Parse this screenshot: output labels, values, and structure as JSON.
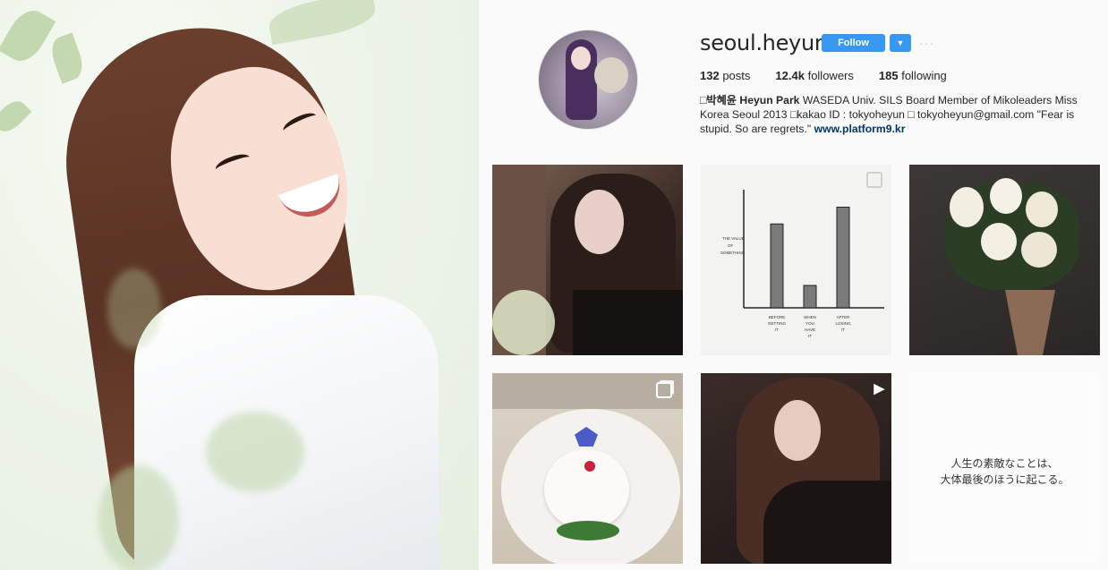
{
  "profile": {
    "username": "seoul.heyun",
    "follow_label": "Follow",
    "more_label": "···",
    "stats": {
      "posts_count": "132",
      "posts_label": "posts",
      "followers_count": "12.4k",
      "followers_label": "followers",
      "following_count": "185",
      "following_label": "following"
    },
    "bio": {
      "prefix_glyph": "□",
      "name": "박혜윤 Heyun Park",
      "text": " WASEDA Univ. SILS Board Member of Mikoleaders Miss Korea Seoul 2013 □kakao ID : tokyoheyun □ tokyoheyun@gmail.com \"Fear is stupid. So are regrets.\" ",
      "link": "www.platform9.kr"
    }
  },
  "posts": {
    "post_5_video_icon": "▶",
    "post_6_text_line1": "人生の素敵なことは、",
    "post_6_text_line2": "大体最後のほうに起こる。"
  },
  "sketch_chart": {
    "ylabel": "THE VALUE OF SOMETHING",
    "categories": [
      "BEFORE GETTING IT",
      "WHEN YOU HAVE IT",
      "AFTER LOSING IT"
    ]
  },
  "chart_data": {
    "type": "bar",
    "title": "",
    "xlabel": "",
    "ylabel": "THE VALUE OF SOMETHING",
    "categories": [
      "BEFORE GETTING IT",
      "WHEN YOU HAVE IT",
      "AFTER LOSING IT"
    ],
    "values": [
      0.75,
      0.2,
      0.9
    ],
    "ylim": [
      0,
      1
    ]
  },
  "colors": {
    "accent": "#3897f0",
    "link": "#003569",
    "text": "#262626"
  }
}
